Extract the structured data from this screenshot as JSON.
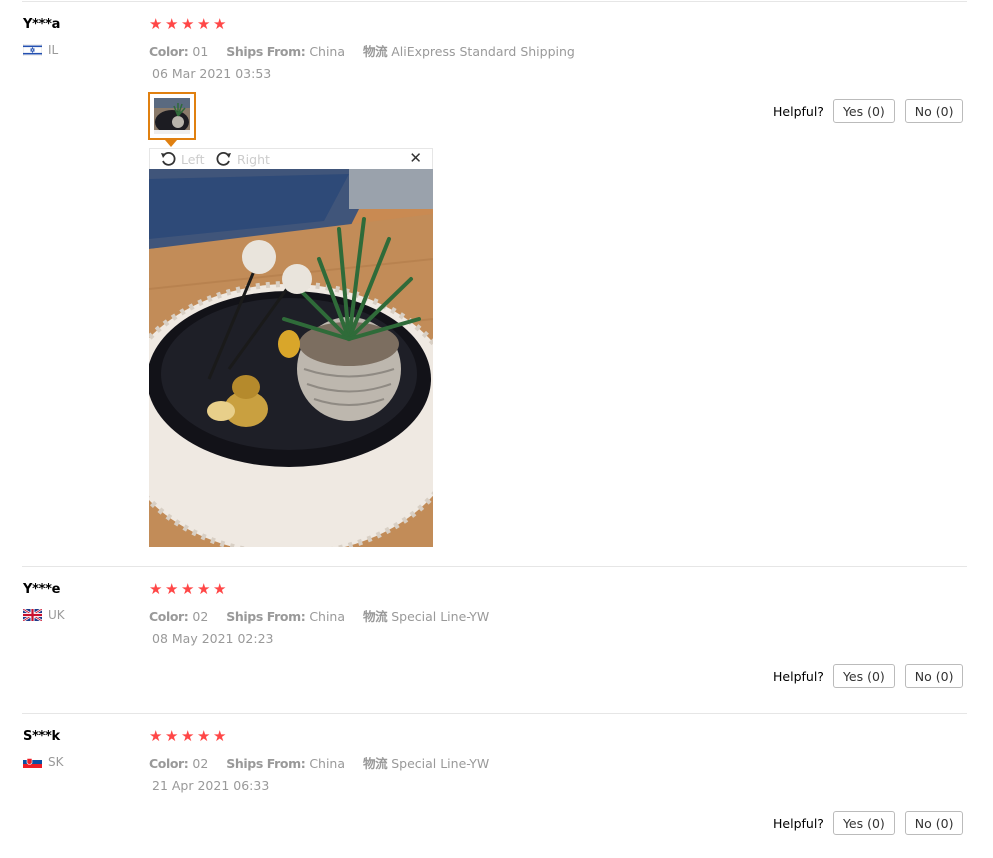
{
  "reviews": [
    {
      "user": "Y***a",
      "country": "IL",
      "stars": 5,
      "color_label": "Color:",
      "color_value": "01",
      "ships_label": "Ships From:",
      "ships_value": "China",
      "logistics_label": "物流",
      "logistics_value": "AliExpress Standard Shipping",
      "date": "06 Mar 2021 03:53",
      "helpful_label": "Helpful?",
      "yes_label": "Yes (0)",
      "no_label": "No (0)"
    },
    {
      "user": "Y***e",
      "country": "UK",
      "stars": 5,
      "color_label": "Color:",
      "color_value": "02",
      "ships_label": "Ships From:",
      "ships_value": "China",
      "logistics_label": "物流",
      "logistics_value": "Special Line-YW",
      "date": "08 May 2021 02:23",
      "helpful_label": "Helpful?",
      "yes_label": "Yes (0)",
      "no_label": "No (0)"
    },
    {
      "user": "S***k",
      "country": "SK",
      "stars": 5,
      "color_label": "Color:",
      "color_value": "02",
      "ships_label": "Ships From:",
      "ships_value": "China",
      "logistics_label": "物流",
      "logistics_value": "Special Line-YW",
      "date": "21 Apr 2021 06:33",
      "helpful_label": "Helpful?",
      "yes_label": "Yes (0)",
      "no_label": "No (0)"
    }
  ],
  "viewer": {
    "rotate_left": "Left",
    "rotate_right": "Right",
    "close_icon": "close-icon",
    "rotate_left_icon": "rotate-left-icon",
    "rotate_right_icon": "rotate-right-icon"
  },
  "colors": {
    "star": "#ff4747",
    "thumb_border": "#e08010",
    "muted_text": "#999999"
  }
}
